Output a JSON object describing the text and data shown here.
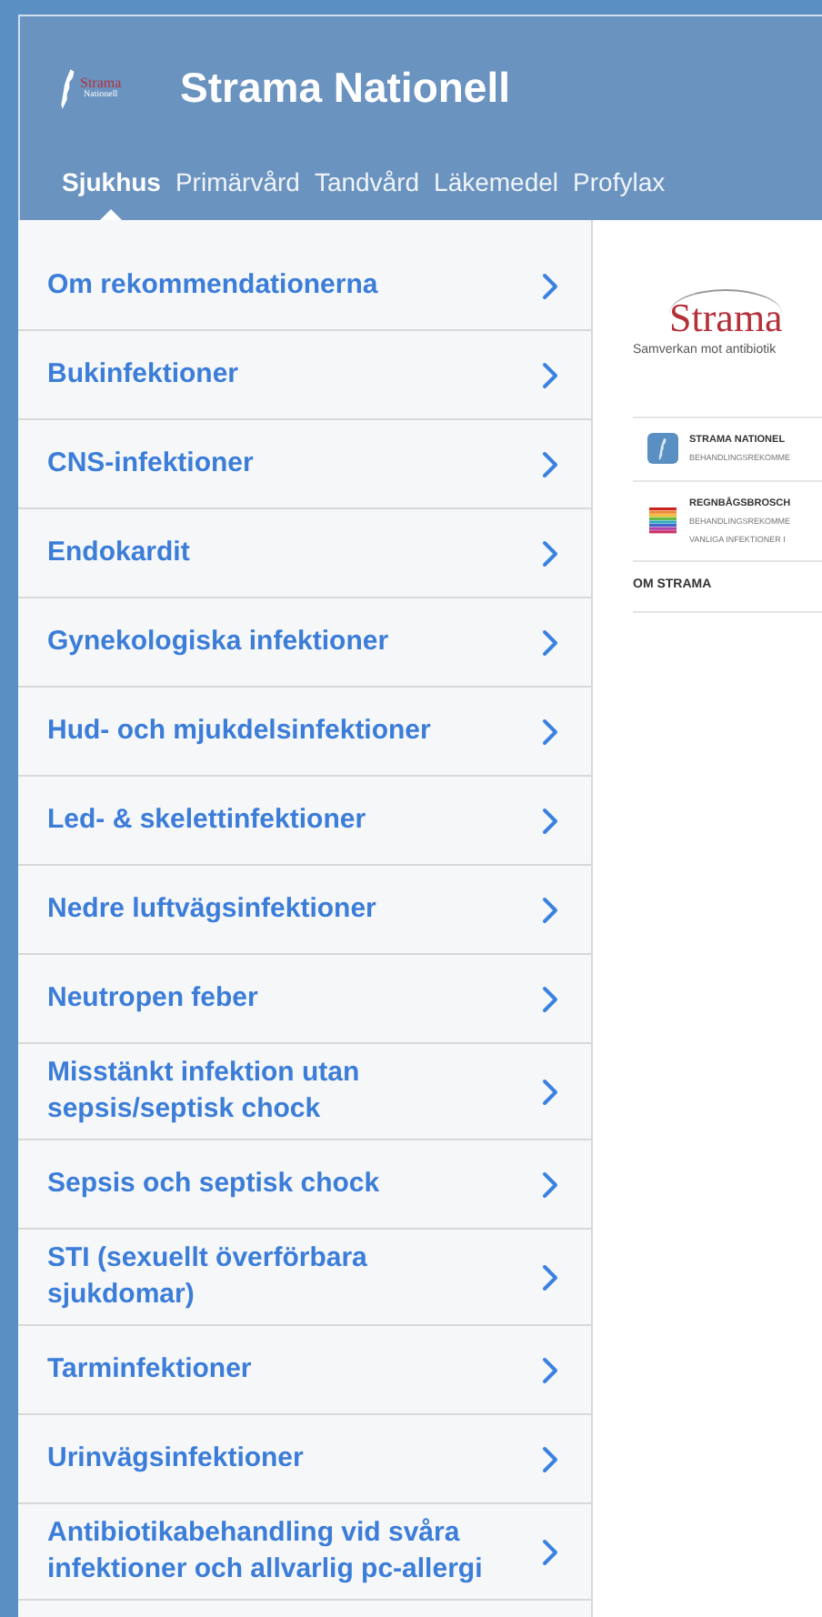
{
  "header": {
    "logo_text": "Strama",
    "logo_subtext": "Nationell",
    "title": "Strama Nationell"
  },
  "tabs": [
    {
      "label": "Sjukhus",
      "selected": true
    },
    {
      "label": "Primärvård",
      "selected": false
    },
    {
      "label": "Tandvård",
      "selected": false
    },
    {
      "label": "Läkemedel",
      "selected": false
    },
    {
      "label": "Profylax",
      "selected": false
    }
  ],
  "sidebar": {
    "items": [
      "Om rekommendationerna",
      "Bukinfektioner",
      "CNS-infektioner",
      "Endokardit",
      "Gynekologiska infektioner",
      "Hud- och mjukdelsinfektioner",
      "Led- & skelettinfektioner",
      "Nedre luftvägsinfektioner",
      "Neutropen feber",
      "Misstänkt infektion utan sepsis/septisk chock",
      "Sepsis och septisk chock",
      "STI (sexuellt överförbara sjukdomar)",
      "Tarminfektioner",
      "Urinvägsinfektioner",
      "Antibiotikabehandling vid svåra infektioner och allvarlig pc-allergi"
    ]
  },
  "content": {
    "logo_text": "Strama",
    "tagline": "Samverkan mot antibiotik",
    "links": [
      {
        "kind": "app",
        "title": "STRAMA NATIONEL",
        "lines": [
          "BEHANDLINGSREKOMME"
        ]
      },
      {
        "kind": "brochure",
        "title": "REGNBÅGSBROSCH",
        "lines": [
          "BEHANDLINGSREKOMME",
          "VANLIGA INFEKTIONER I"
        ]
      },
      {
        "kind": "plain",
        "title": "OM STRAMA"
      }
    ]
  }
}
